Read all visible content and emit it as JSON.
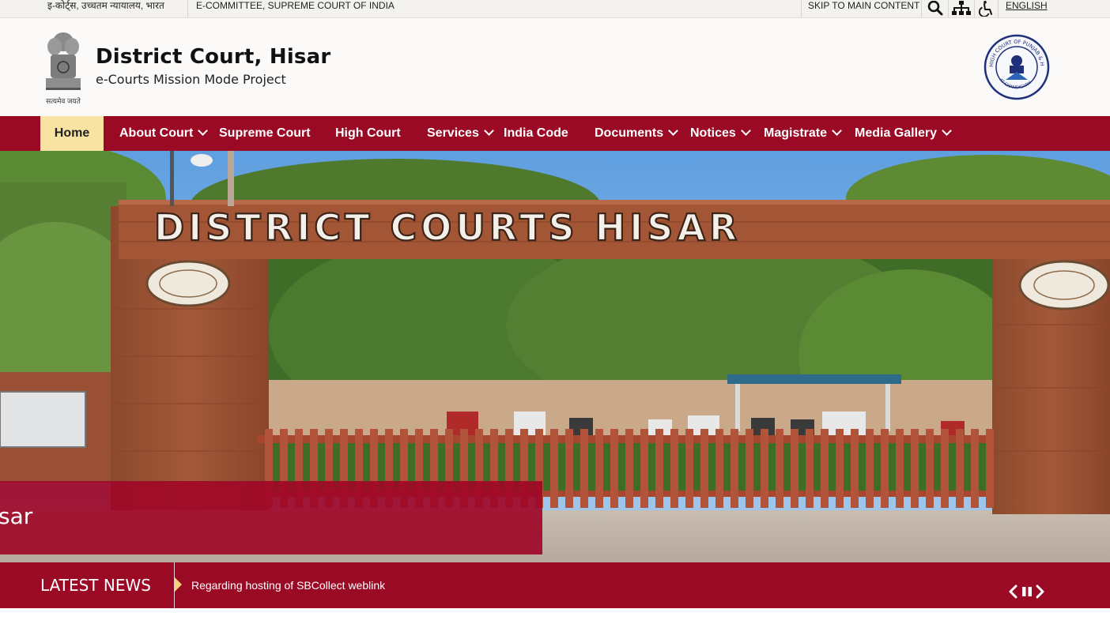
{
  "topbar": {
    "hindi_text": "इ-कोर्ट्स, उच्चतम न्यायालय, भारत",
    "committee": "E-COMMITTEE, SUPREME COURT OF INDIA",
    "skip": "SKIP TO MAIN CONTENT",
    "language": "ENGLISH"
  },
  "header": {
    "title": "District Court, Hisar",
    "subtitle": "e-Courts Mission Mode Project",
    "emblem_motto": "सत्यमेव जयते",
    "hc_logo_text": "HIGH COURT OF PUNJAB & HARYANA",
    "hc_logo_sub": "AT CHANDIGARH"
  },
  "nav": {
    "items": [
      {
        "label": "Home",
        "dropdown": false,
        "active": true
      },
      {
        "label": "About Court",
        "dropdown": true,
        "active": false
      },
      {
        "label": "Supreme Court",
        "dropdown": false,
        "active": false
      },
      {
        "label": "High Court",
        "dropdown": false,
        "active": false
      },
      {
        "label": "Services",
        "dropdown": true,
        "active": false
      },
      {
        "label": "India Code",
        "dropdown": false,
        "active": false
      },
      {
        "label": "Documents",
        "dropdown": true,
        "active": false
      },
      {
        "label": "Notices",
        "dropdown": true,
        "active": false
      },
      {
        "label": "Magistrate",
        "dropdown": true,
        "active": false
      },
      {
        "label": "Media Gallery",
        "dropdown": true,
        "active": false
      }
    ]
  },
  "hero": {
    "sign_text": "DISTRICT COURTS HISAR",
    "caption": "sar"
  },
  "news": {
    "label": "LATEST NEWS",
    "item": "Regarding hosting of SBCollect weblink"
  },
  "colors": {
    "brand": "#9b0a25",
    "active_nav": "#f8e3a3",
    "news_arrow": "#f6d27a"
  },
  "icons": [
    "search-icon",
    "sitemap-icon",
    "accessibility-icon",
    "chevron-down-icon",
    "prev-icon",
    "pause-icon",
    "next-icon"
  ]
}
